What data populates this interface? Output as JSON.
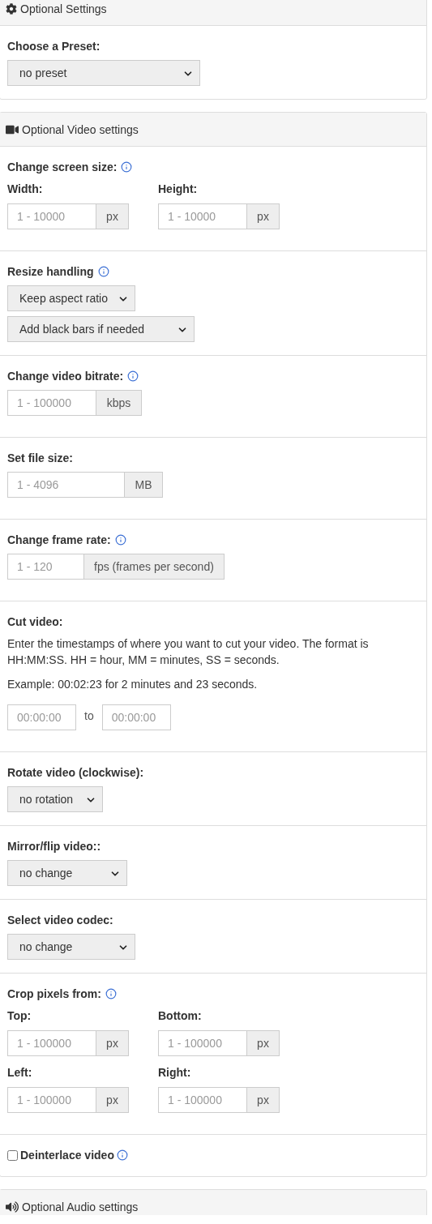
{
  "panels": [
    {
      "title": "Optional Settings",
      "sections": [
        {
          "kind": "select",
          "label": "Choose a Preset:",
          "info": false,
          "value": "no preset"
        }
      ]
    },
    {
      "title": "Optional Video settings",
      "sections": [
        {
          "kind": "pair",
          "label": "Change screen size:",
          "info": true,
          "fields": [
            {
              "label": "Width:",
              "placeholder": "1 - 10000",
              "unit": "px"
            },
            {
              "label": "Height:",
              "placeholder": "1 - 10000",
              "unit": "px"
            }
          ]
        },
        {
          "kind": "selects",
          "label": "Resize handling",
          "info": true,
          "values": [
            "Keep aspect ratio",
            "Add black bars if needed"
          ]
        },
        {
          "kind": "addon",
          "label": "Change video bitrate:",
          "info": true,
          "placeholder": "1 - 100000",
          "unit": "kbps"
        },
        {
          "kind": "addon",
          "label": "Set file size:",
          "info": false,
          "placeholder": "1 - 4096",
          "unit": "MB"
        },
        {
          "kind": "addon",
          "label": "Change frame rate:",
          "info": true,
          "placeholder": "1 - 120",
          "unit": "fps (frames per second)"
        },
        {
          "kind": "cut",
          "label": "Cut video:",
          "info": false,
          "paragraphs": [
            "Enter the timestamps of where you want to cut your video. The format is HH:MM:SS. HH = hour, MM = minutes, SS = seconds.",
            "Example: 00:02:23 for 2 minutes and 23 seconds."
          ],
          "from_placeholder": "00:00:00",
          "separator": "to",
          "to_placeholder": "00:00:00"
        },
        {
          "kind": "select",
          "label": "Rotate video (clockwise):",
          "info": false,
          "value": "no rotation"
        },
        {
          "kind": "select",
          "label": "Mirror/flip video::",
          "info": false,
          "value": "no change"
        },
        {
          "kind": "select",
          "label": "Select video codec:",
          "info": false,
          "value": "no change"
        },
        {
          "kind": "pair",
          "label": "Crop pixels from:",
          "info": true,
          "fields": [
            {
              "label": "Top:",
              "placeholder": "1 - 100000",
              "unit": "px"
            },
            {
              "label": "Bottom:",
              "placeholder": "1 - 100000",
              "unit": "px"
            },
            {
              "label": "Left:",
              "placeholder": "1 - 100000",
              "unit": "px"
            },
            {
              "label": "Right:",
              "placeholder": "1 - 100000",
              "unit": "px"
            }
          ]
        },
        {
          "kind": "checkbox",
          "label": "Deinterlace video",
          "info": true,
          "checked": false
        }
      ]
    },
    {
      "title": "Optional Audio settings"
    }
  ]
}
